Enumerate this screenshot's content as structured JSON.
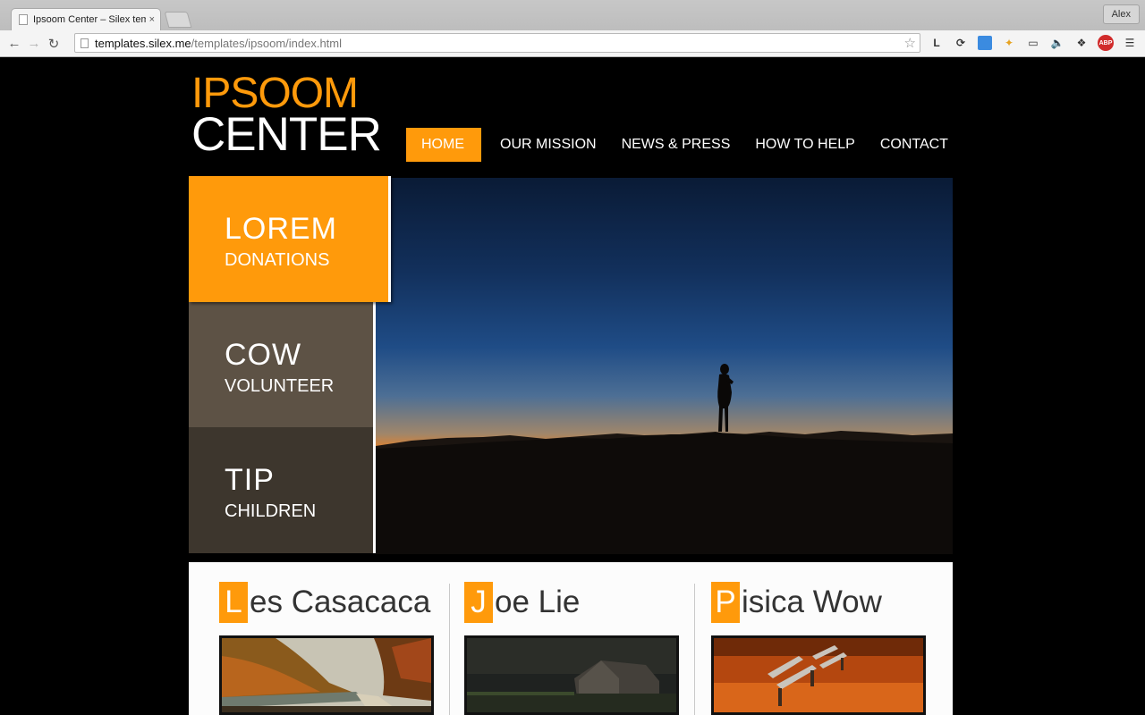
{
  "browser": {
    "tab_title": "Ipsoom Center – Silex tem",
    "tab_close": "×",
    "profile": "Alex",
    "url_host": "templates.silex.me",
    "url_path": "/templates/ipsoom/index.html",
    "extensions": [
      "L",
      "sync",
      "check",
      "star-ext",
      "cast",
      "speaker",
      "puzzle",
      "ABP"
    ]
  },
  "site": {
    "logo_line1": "IPSOOM",
    "logo_line2": "CENTER",
    "nav": [
      {
        "label": "HOME",
        "active": true
      },
      {
        "label": "OUR MISSION",
        "active": false
      },
      {
        "label": "NEWS & PRESS",
        "active": false
      },
      {
        "label": "HOW TO HELP",
        "active": false
      },
      {
        "label": "CONTACT",
        "active": false
      }
    ],
    "menu": [
      {
        "big": "LOREM",
        "small": "DONATIONS"
      },
      {
        "big": "COW",
        "small": "VOLUNTEER"
      },
      {
        "big": "TIP",
        "small": "CHILDREN"
      }
    ],
    "cards": [
      {
        "cap": "L",
        "rest": "es Casacaca",
        "image": "autumn-river-road"
      },
      {
        "cap": "J",
        "rest": "oe Lie",
        "image": "barn-at-night"
      },
      {
        "cap": "P",
        "rest": "isica Wow",
        "image": "benches-autumn-leaves"
      }
    ]
  },
  "colors": {
    "accent": "#ff9a0b",
    "menu_mid": "#5d5245",
    "menu_dark": "#3d362d"
  }
}
